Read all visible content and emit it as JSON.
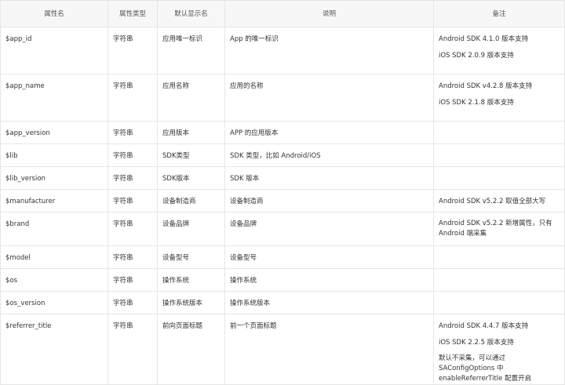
{
  "headers": [
    "属性名",
    "属性类型",
    "默认显示名",
    "说明",
    "备注"
  ],
  "rows": [
    {
      "name": "$app_id",
      "type": "字符串",
      "display": "应用唯一标识",
      "desc": "App 的唯一标识",
      "notes": [
        "Android SDK 4.1.0 版本支持",
        "iOS SDK 2.0.9 版本支持"
      ]
    },
    {
      "name": "$app_name",
      "type": "字符串",
      "display": "应用名称",
      "desc": "应用的名称",
      "notes": [
        "Android SDK v4.2.8 版本支持",
        "iOS SDK 2.1.8 版本支持"
      ]
    },
    {
      "name": "$app_version",
      "type": "字符串",
      "display": "应用版本",
      "desc": "APP 的应用版本",
      "notes": []
    },
    {
      "name": "$lib",
      "type": "字符串",
      "display": "SDK类型",
      "desc": "SDK 类型，比如 Android/iOS",
      "notes": []
    },
    {
      "name": "$lib_version",
      "type": "字符串",
      "display": "SDK版本",
      "desc": "SDK 版本",
      "notes": []
    },
    {
      "name": "$manufacturer",
      "type": "字符串",
      "display": "设备制造商",
      "desc": "设备制造商",
      "notes": [
        "Android SDK v5.2.2 取值全部大写"
      ]
    },
    {
      "name": "$brand",
      "type": "字符串",
      "display": "设备品牌",
      "desc": "设备品牌",
      "notes": [
        " Android SDK v5.2.2 新增属性，只有 Android 端采集"
      ]
    },
    {
      "name": "$model",
      "type": "字符串",
      "display": "设备型号",
      "desc": "设备型号",
      "notes": []
    },
    {
      "name": "$os",
      "type": "字符串",
      "display": "操作系统",
      "desc": "操作系统",
      "notes": []
    },
    {
      "name": "$os_version",
      "type": "字符串",
      "display": "操作系统版本",
      "desc": "操作系统版本",
      "notes": []
    },
    {
      "name": "$referrer_title",
      "type": "字符串",
      "display": "前向页面标题",
      "desc": "前一个页面标题",
      "notes": [
        "Android SDK 4.4.7 版本支持",
        "iOS SDK 2.2.5 版本支持",
        "默认不采集，可以通过 SAConfigOptions 中 enableReferrerTitle 配置开启"
      ]
    }
  ]
}
